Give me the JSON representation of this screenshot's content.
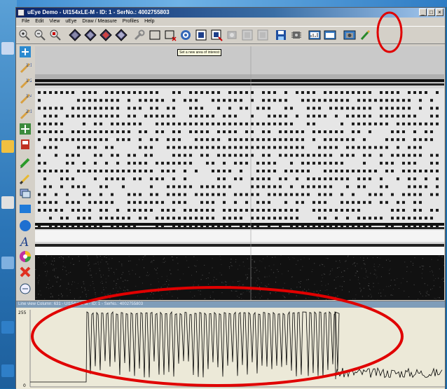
{
  "window": {
    "title": "uEye Demo - UI154xLE-M - ID: 1 - SerNo.: 4002755803",
    "controls": [
      "_",
      "□",
      "×"
    ]
  },
  "menu": [
    "File",
    "Edit",
    "View",
    "uEye",
    "Draw / Measure",
    "Profiles",
    "Help"
  ],
  "toolbar": {
    "icons": [
      "zoom-in-icon",
      "zoom-out-icon",
      "zoom-fit-icon",
      "diamond-icon-1",
      "diamond-icon-2",
      "diamond-icon-3",
      "diamond-icon-4",
      "wrench-icon",
      "rectangle-icon",
      "rectangle-cut-icon",
      "target-icon",
      "blue-square-icon",
      "aoi-square-icon",
      "save-grey-icon",
      "grey-square-icon",
      "grey-square-icon-2",
      "save-icon",
      "chip-icon",
      "chart-icon",
      "window-icon",
      "camera-icon",
      "pen-icon"
    ]
  },
  "tooltip": {
    "text": "Set a new area of interest"
  },
  "lefttools": [
    "grid-icon",
    "scale-1-1-icon",
    "scale-1-2-icon",
    "scale-1-4-icon",
    "scale-2-1-icon",
    "cross-icon",
    "save-red-icon",
    "pencil-icon",
    "brush-icon",
    "layers-icon",
    "rectangle-fill-icon",
    "circle-icon",
    "text-a-icon",
    "color-wheel-icon",
    "delete-x-icon",
    "magnifier-icon"
  ],
  "subwindow": {
    "title": "Line view Column: 631 - UI154xLE-M - ID: 1 - SerNo.: 4002755803",
    "y_max_label": "255",
    "y_min_label": "0"
  },
  "colors": {
    "highlight_ring": "#e00000",
    "titlebar": "#0a246a"
  }
}
